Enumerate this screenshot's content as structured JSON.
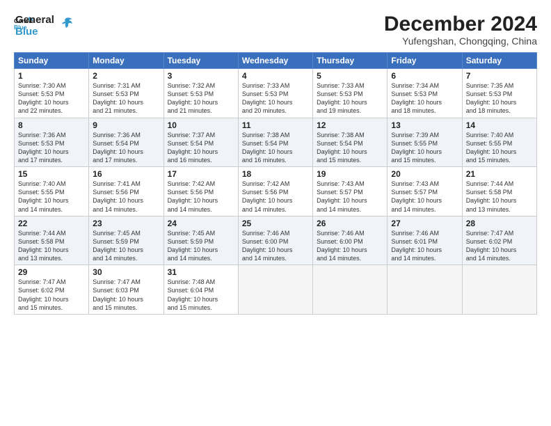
{
  "brand": {
    "name_general": "General",
    "name_blue": "Blue"
  },
  "header": {
    "month": "December 2024",
    "location": "Yufengshan, Chongqing, China"
  },
  "weekdays": [
    "Sunday",
    "Monday",
    "Tuesday",
    "Wednesday",
    "Thursday",
    "Friday",
    "Saturday"
  ],
  "weeks": [
    [
      {
        "day": "1",
        "sunrise": "7:30 AM",
        "sunset": "5:53 PM",
        "daylight": "10 hours and 22 minutes."
      },
      {
        "day": "2",
        "sunrise": "7:31 AM",
        "sunset": "5:53 PM",
        "daylight": "10 hours and 21 minutes."
      },
      {
        "day": "3",
        "sunrise": "7:32 AM",
        "sunset": "5:53 PM",
        "daylight": "10 hours and 21 minutes."
      },
      {
        "day": "4",
        "sunrise": "7:33 AM",
        "sunset": "5:53 PM",
        "daylight": "10 hours and 20 minutes."
      },
      {
        "day": "5",
        "sunrise": "7:33 AM",
        "sunset": "5:53 PM",
        "daylight": "10 hours and 19 minutes."
      },
      {
        "day": "6",
        "sunrise": "7:34 AM",
        "sunset": "5:53 PM",
        "daylight": "10 hours and 18 minutes."
      },
      {
        "day": "7",
        "sunrise": "7:35 AM",
        "sunset": "5:53 PM",
        "daylight": "10 hours and 18 minutes."
      }
    ],
    [
      {
        "day": "8",
        "sunrise": "7:36 AM",
        "sunset": "5:53 PM",
        "daylight": "10 hours and 17 minutes."
      },
      {
        "day": "9",
        "sunrise": "7:36 AM",
        "sunset": "5:54 PM",
        "daylight": "10 hours and 17 minutes."
      },
      {
        "day": "10",
        "sunrise": "7:37 AM",
        "sunset": "5:54 PM",
        "daylight": "10 hours and 16 minutes."
      },
      {
        "day": "11",
        "sunrise": "7:38 AM",
        "sunset": "5:54 PM",
        "daylight": "10 hours and 16 minutes."
      },
      {
        "day": "12",
        "sunrise": "7:38 AM",
        "sunset": "5:54 PM",
        "daylight": "10 hours and 15 minutes."
      },
      {
        "day": "13",
        "sunrise": "7:39 AM",
        "sunset": "5:55 PM",
        "daylight": "10 hours and 15 minutes."
      },
      {
        "day": "14",
        "sunrise": "7:40 AM",
        "sunset": "5:55 PM",
        "daylight": "10 hours and 15 minutes."
      }
    ],
    [
      {
        "day": "15",
        "sunrise": "7:40 AM",
        "sunset": "5:55 PM",
        "daylight": "10 hours and 14 minutes."
      },
      {
        "day": "16",
        "sunrise": "7:41 AM",
        "sunset": "5:56 PM",
        "daylight": "10 hours and 14 minutes."
      },
      {
        "day": "17",
        "sunrise": "7:42 AM",
        "sunset": "5:56 PM",
        "daylight": "10 hours and 14 minutes."
      },
      {
        "day": "18",
        "sunrise": "7:42 AM",
        "sunset": "5:56 PM",
        "daylight": "10 hours and 14 minutes."
      },
      {
        "day": "19",
        "sunrise": "7:43 AM",
        "sunset": "5:57 PM",
        "daylight": "10 hours and 14 minutes."
      },
      {
        "day": "20",
        "sunrise": "7:43 AM",
        "sunset": "5:57 PM",
        "daylight": "10 hours and 14 minutes."
      },
      {
        "day": "21",
        "sunrise": "7:44 AM",
        "sunset": "5:58 PM",
        "daylight": "10 hours and 13 minutes."
      }
    ],
    [
      {
        "day": "22",
        "sunrise": "7:44 AM",
        "sunset": "5:58 PM",
        "daylight": "10 hours and 13 minutes."
      },
      {
        "day": "23",
        "sunrise": "7:45 AM",
        "sunset": "5:59 PM",
        "daylight": "10 hours and 14 minutes."
      },
      {
        "day": "24",
        "sunrise": "7:45 AM",
        "sunset": "5:59 PM",
        "daylight": "10 hours and 14 minutes."
      },
      {
        "day": "25",
        "sunrise": "7:46 AM",
        "sunset": "6:00 PM",
        "daylight": "10 hours and 14 minutes."
      },
      {
        "day": "26",
        "sunrise": "7:46 AM",
        "sunset": "6:00 PM",
        "daylight": "10 hours and 14 minutes."
      },
      {
        "day": "27",
        "sunrise": "7:46 AM",
        "sunset": "6:01 PM",
        "daylight": "10 hours and 14 minutes."
      },
      {
        "day": "28",
        "sunrise": "7:47 AM",
        "sunset": "6:02 PM",
        "daylight": "10 hours and 14 minutes."
      }
    ],
    [
      {
        "day": "29",
        "sunrise": "7:47 AM",
        "sunset": "6:02 PM",
        "daylight": "10 hours and 15 minutes."
      },
      {
        "day": "30",
        "sunrise": "7:47 AM",
        "sunset": "6:03 PM",
        "daylight": "10 hours and 15 minutes."
      },
      {
        "day": "31",
        "sunrise": "7:48 AM",
        "sunset": "6:04 PM",
        "daylight": "10 hours and 15 minutes."
      },
      null,
      null,
      null,
      null
    ]
  ],
  "labels": {
    "sunrise": "Sunrise:",
    "sunset": "Sunset:",
    "daylight": "Daylight:"
  }
}
